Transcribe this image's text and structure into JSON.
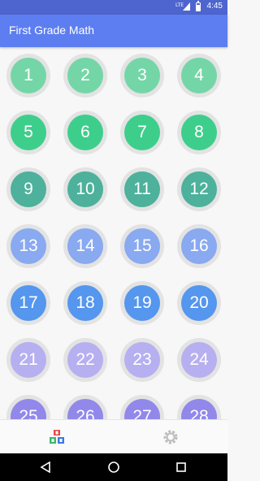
{
  "status_bar": {
    "time": "4:45",
    "network_label": "LTE"
  },
  "app_bar": {
    "title": "First Grade Math"
  },
  "levels": [
    {
      "label": "1",
      "color": "#74d6a7"
    },
    {
      "label": "2",
      "color": "#74d6a7"
    },
    {
      "label": "3",
      "color": "#74d6a7"
    },
    {
      "label": "4",
      "color": "#74d6a7"
    },
    {
      "label": "5",
      "color": "#3ece8c"
    },
    {
      "label": "6",
      "color": "#3ece8c"
    },
    {
      "label": "7",
      "color": "#3ece8c"
    },
    {
      "label": "8",
      "color": "#3ece8c"
    },
    {
      "label": "9",
      "color": "#4db19b"
    },
    {
      "label": "10",
      "color": "#4db19b"
    },
    {
      "label": "11",
      "color": "#4db19b"
    },
    {
      "label": "12",
      "color": "#4db19b"
    },
    {
      "label": "13",
      "color": "#89a9f0"
    },
    {
      "label": "14",
      "color": "#89a9f0"
    },
    {
      "label": "15",
      "color": "#89a9f0"
    },
    {
      "label": "16",
      "color": "#89a9f0"
    },
    {
      "label": "17",
      "color": "#5596ee"
    },
    {
      "label": "18",
      "color": "#5596ee"
    },
    {
      "label": "19",
      "color": "#5596ee"
    },
    {
      "label": "20",
      "color": "#5596ee"
    },
    {
      "label": "21",
      "color": "#b6aff0"
    },
    {
      "label": "22",
      "color": "#b6aff0"
    },
    {
      "label": "23",
      "color": "#b6aff0"
    },
    {
      "label": "24",
      "color": "#b6aff0"
    },
    {
      "label": "25",
      "color": "#9188ea"
    },
    {
      "label": "26",
      "color": "#9188ea"
    },
    {
      "label": "27",
      "color": "#9188ea"
    },
    {
      "label": "28",
      "color": "#9188ea"
    }
  ],
  "bottom_tabs": [
    {
      "icon": "abc-blocks-icon"
    },
    {
      "icon": "gear-icon"
    }
  ],
  "nav_bar": {
    "buttons": [
      {
        "icon": "back-triangle-icon"
      },
      {
        "icon": "home-circle-icon"
      },
      {
        "icon": "recents-square-icon"
      }
    ]
  }
}
